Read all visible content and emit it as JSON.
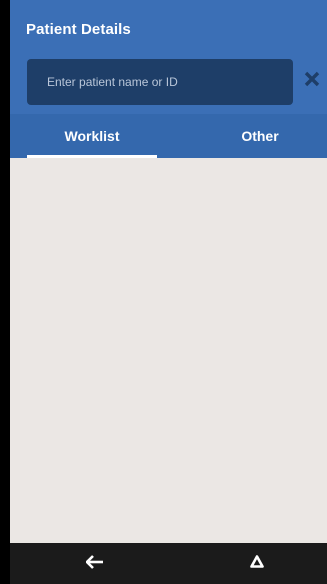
{
  "header": {
    "title": "Patient Details"
  },
  "search": {
    "placeholder": "Enter patient name or ID",
    "value": "",
    "clear_icon": "close-icon"
  },
  "tabs": [
    {
      "label": "Worklist",
      "selected": true
    },
    {
      "label": "Other",
      "selected": false
    }
  ],
  "navbar": {
    "back_icon": "arrow-left-icon",
    "home_icon": "triangle-up-icon"
  },
  "colors": {
    "header_bg": "#3b6fb6",
    "tab_bar_bg": "#3468ad",
    "search_bg": "#1e3e68",
    "content_bg": "#ebe7e4",
    "navbar_bg": "#1b1b1b"
  }
}
